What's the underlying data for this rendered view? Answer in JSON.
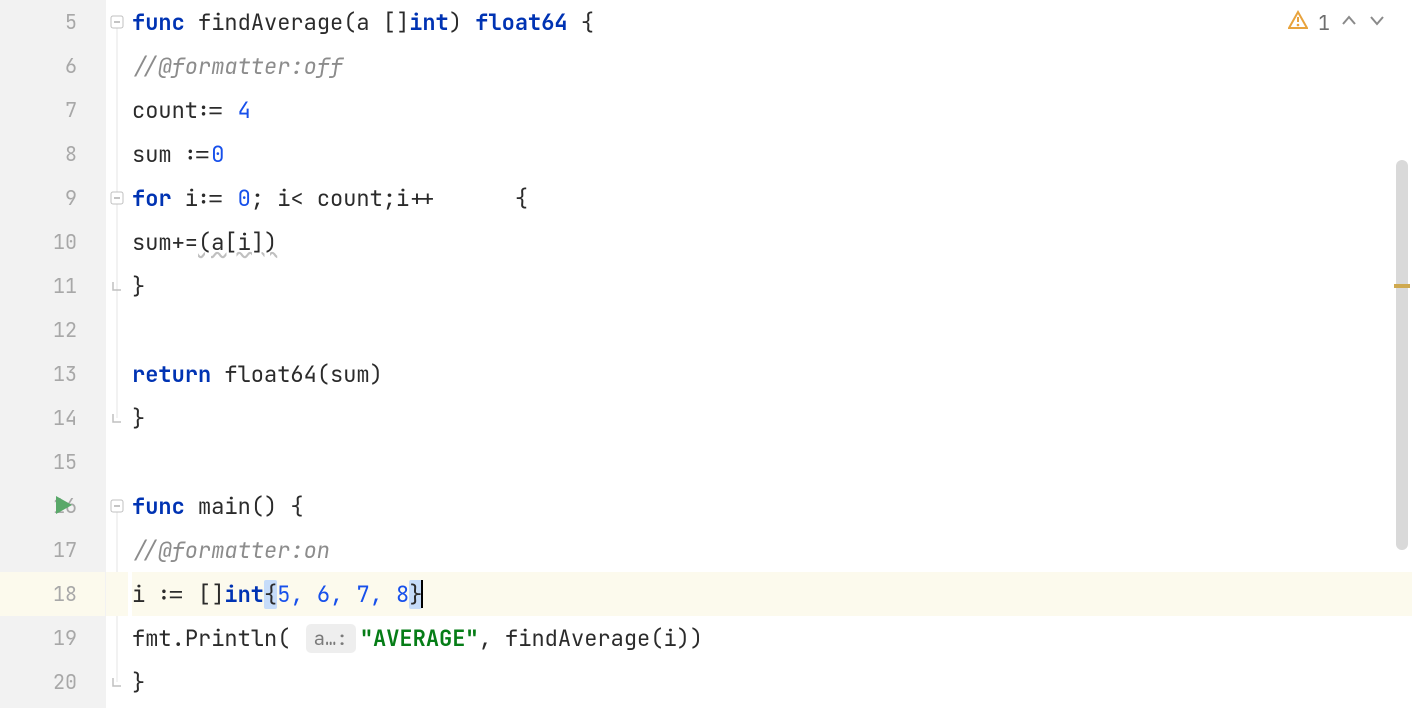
{
  "inspections": {
    "warning_count": "1"
  },
  "lines": [
    {
      "n": "5"
    },
    {
      "n": "6"
    },
    {
      "n": "7"
    },
    {
      "n": "8"
    },
    {
      "n": "9"
    },
    {
      "n": "10"
    },
    {
      "n": "11"
    },
    {
      "n": "12"
    },
    {
      "n": "13"
    },
    {
      "n": "14"
    },
    {
      "n": "15"
    },
    {
      "n": "16"
    },
    {
      "n": "17"
    },
    {
      "n": "18"
    },
    {
      "n": "19"
    },
    {
      "n": "20"
    }
  ],
  "code": {
    "l5": {
      "kw_func": "func",
      "name": " findAverage(a []",
      "kw_int": "int",
      "after": ") ",
      "kw_float": "float64",
      "brace": " {"
    },
    "l6": {
      "comment": "//@formatter:off"
    },
    "l7": {
      "text1": "count:= ",
      "num": "4"
    },
    "l8": {
      "text1": "sum :=",
      "num": "0"
    },
    "l9": {
      "kw_for": "for",
      "text1": " i:= ",
      "num0": "0",
      "text2": "; i< count;i++      {"
    },
    "l10": {
      "text1": "sum+=",
      "wavy": "(a[i])"
    },
    "l11": {
      "brace": "}"
    },
    "l13": {
      "kw_return": "return",
      "text": " float64(sum)"
    },
    "l14": {
      "brace": "}"
    },
    "l16": {
      "kw_func": "func",
      "name": " main() {"
    },
    "l17": {
      "comment": "//@formatter:on"
    },
    "l18": {
      "text1": "i := []",
      "kw_int": "int",
      "br_open": "{",
      "nums": "5, 6, 7, 8",
      "br_close": "}"
    },
    "l19": {
      "pkg": "fmt.",
      "fn": "Println",
      "paren": "( ",
      "hint": "a…:",
      "str": "\"AVERAGE\"",
      "rest": ", findAverage(i))"
    },
    "l20": {
      "brace": "}"
    }
  },
  "icons": {
    "run": "run-icon",
    "bulb": "bulb-icon",
    "warning": "warning-triangle-icon",
    "chev_up": "chevron-up-icon",
    "chev_down": "chevron-down-icon",
    "fold_open_down": "fold-open-icon",
    "fold_end": "fold-end-icon"
  }
}
